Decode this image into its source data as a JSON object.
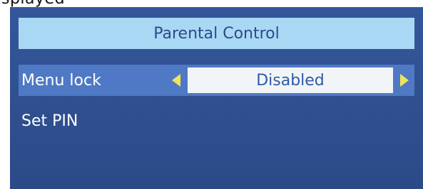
{
  "caption_fragment": "splayed",
  "menu": {
    "title": "Parental Control",
    "items": [
      {
        "label": "Menu lock",
        "value": "Disabled",
        "left_arrow_icon": "triangle-left-icon",
        "right_arrow_icon": "triangle-right-icon"
      },
      {
        "label": "Set PIN"
      }
    ]
  },
  "colors": {
    "panel": "#2f4f8f",
    "title_bar": "#a9d8f5",
    "selected_row": "#4f79c4",
    "value_box": "#f2f5f8",
    "arrows": "#f2e35a",
    "value_text": "#2f5aa8"
  }
}
